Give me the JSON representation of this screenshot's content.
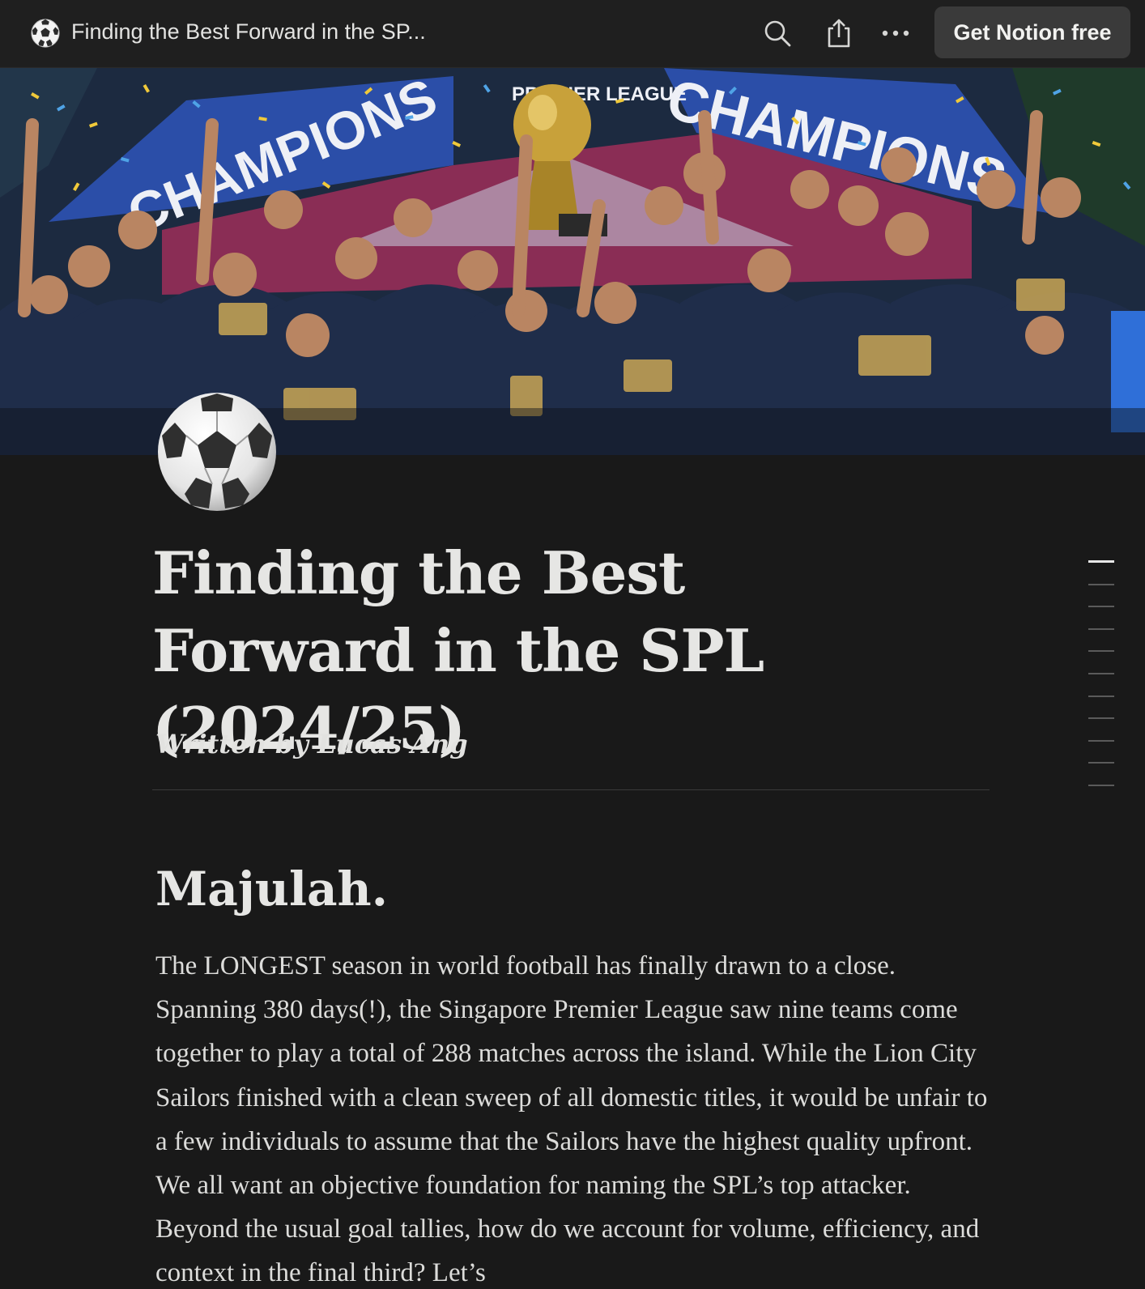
{
  "topbar": {
    "page_icon": "soccer-ball-icon",
    "title": "Finding the Best Forward in the SP...",
    "search_icon": "search-icon",
    "share_icon": "share-icon",
    "more_icon": "more-icon",
    "cta_label": "Get Notion free"
  },
  "cover": {
    "banner_left": "CHAMPIONS",
    "banner_right": "CHAMPIONS",
    "banner_top": "PREMIER LEAGUE"
  },
  "page": {
    "icon": "soccer-ball-icon",
    "title": "Finding the Best Forward in the SPL (2024/25)",
    "byline": "Written by Lucas Ang",
    "heading": "Majulah.",
    "paragraph": "The LONGEST season in world football has finally drawn to a close. Spanning 380 days(!), the Singapore Premier League saw nine teams come together to play a total of 288 matches across the island. While the Lion City Sailors finished with a clean sweep of all domestic titles, it would be unfair to a few individuals to assume that the Sailors have the highest quality upfront. We all want an objective foundation for naming the SPL’s top attacker. Beyond the usual goal tallies, how do we account for volume, efficiency, and context in the final third? Let’s"
  },
  "toc": {
    "count": 11,
    "active_index": 0
  },
  "colors": {
    "background": "#191919",
    "topbar": "#1f1f1f",
    "cta_bg": "#3a3a3a",
    "text": "#e6e6e4"
  }
}
